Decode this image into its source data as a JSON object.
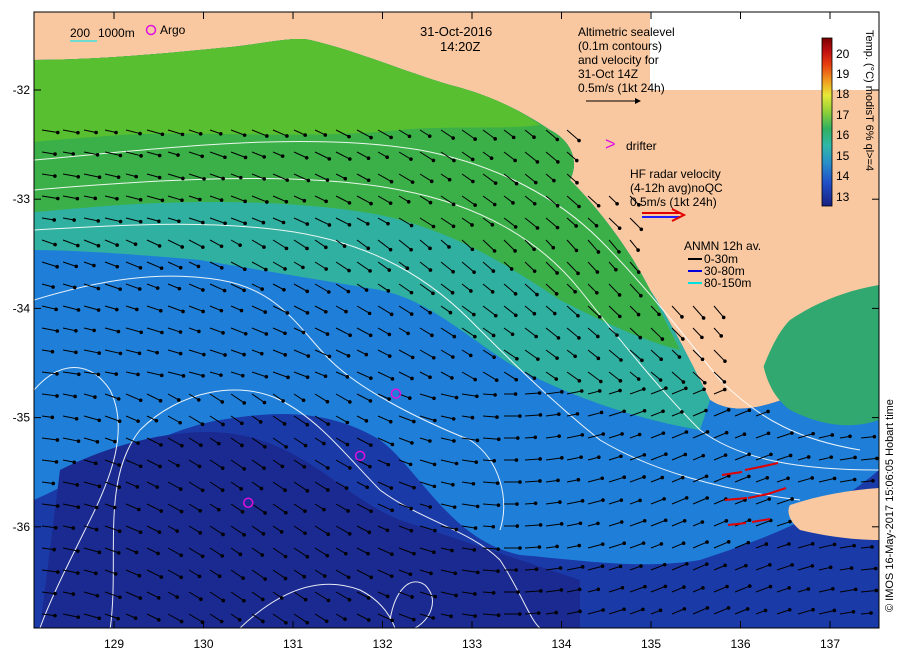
{
  "header": {
    "date": "31-Oct-2016",
    "time": "14:20Z"
  },
  "bathy_legend": {
    "label_200": "200",
    "label_1000": "1000m"
  },
  "argo_legend": {
    "label": "Argo"
  },
  "altimetry_note": {
    "lines": [
      "Altimetric sealevel",
      "(0.1m contours)",
      "and velocity for",
      "31-Oct 14Z",
      "0.5m/s (1kt 24h)"
    ]
  },
  "drifter_legend": {
    "symbol": ">",
    "label": "drifter"
  },
  "hf_radar_note": {
    "lines": [
      "HF radar velocity",
      "(4-12h avg)noQC",
      "0.5m/s (1kt 24h)"
    ]
  },
  "anmn_legend": {
    "title": "ANMN 12h av.",
    "items": [
      {
        "label": "0-30m",
        "color": "#000000"
      },
      {
        "label": "30-80m",
        "color": "#0000dd"
      },
      {
        "label": "80-150m",
        "color": "#00e0e0"
      }
    ]
  },
  "colorbar": {
    "ticks": [
      "20",
      "19",
      "18",
      "17",
      "16",
      "15",
      "14",
      "13"
    ],
    "title": "Temp. (°C) modisT 6% ql>=4",
    "colors": [
      "#7a0000",
      "#c01010",
      "#e84010",
      "#f08020",
      "#f0c030",
      "#e8e838",
      "#a8d838",
      "#50c040",
      "#30b070",
      "#30b8a8",
      "#2890c8",
      "#2060d0",
      "#1838b0",
      "#182080"
    ]
  },
  "credit": "© IMOS 16-May-2017 15:06:05 Hobart time",
  "axes": {
    "lon_ticks": [
      "129",
      "130",
      "131",
      "132",
      "133",
      "134",
      "135",
      "136",
      "137"
    ],
    "lat_ticks": [
      "-32",
      "-33",
      "-34",
      "-35",
      "-36"
    ]
  },
  "argo_floats": [
    {
      "lon": 132.15,
      "lat": -34.78
    },
    {
      "lon": 131.75,
      "lat": -35.35
    },
    {
      "lon": 130.5,
      "lat": -35.78
    }
  ],
  "colors": {
    "land": "#f9c8a0",
    "argo": "#e010e0",
    "hf_red": "#e00000",
    "hf_blue": "#2020ff"
  }
}
